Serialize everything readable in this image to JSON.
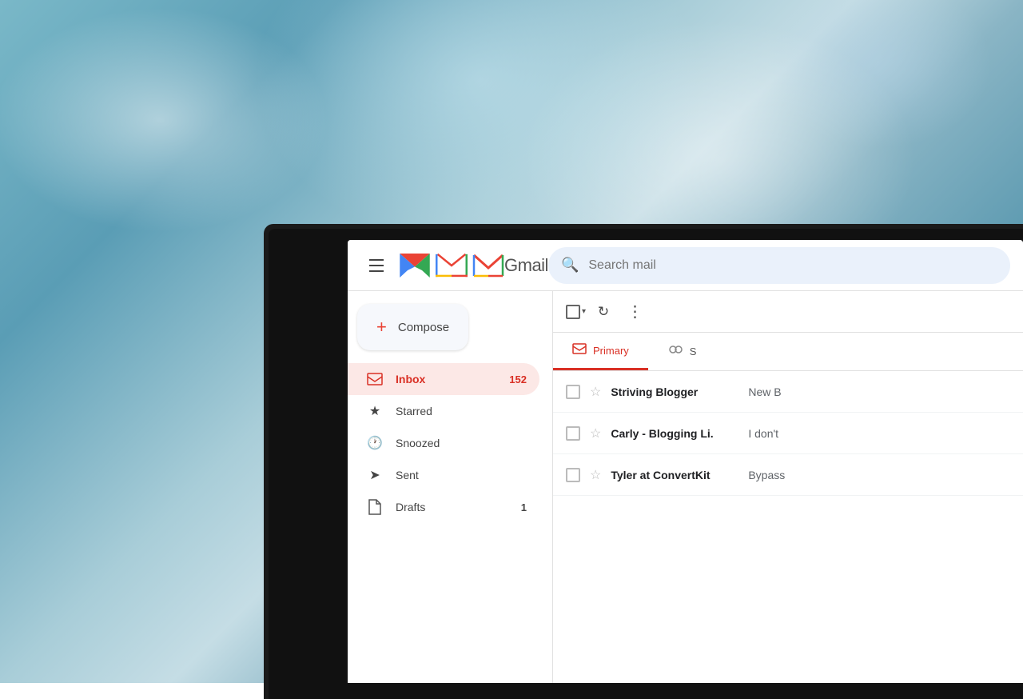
{
  "background": {
    "description": "Blurred blue-white abstract background"
  },
  "header": {
    "menu_label": "Main menu",
    "logo_text": "Gmail",
    "search_placeholder": "Search mail"
  },
  "compose": {
    "label": "Compose",
    "plus_symbol": "+"
  },
  "nav": {
    "items": [
      {
        "id": "inbox",
        "label": "Inbox",
        "icon": "inbox",
        "badge": "152",
        "active": true
      },
      {
        "id": "starred",
        "label": "Starred",
        "icon": "star",
        "badge": "",
        "active": false
      },
      {
        "id": "snoozed",
        "label": "Snoozed",
        "icon": "clock",
        "badge": "",
        "active": false
      },
      {
        "id": "sent",
        "label": "Sent",
        "icon": "send",
        "badge": "",
        "active": false
      },
      {
        "id": "drafts",
        "label": "Drafts",
        "icon": "draft",
        "badge": "1",
        "active": false
      }
    ]
  },
  "toolbar": {
    "select_all_label": "Select all",
    "refresh_label": "Refresh",
    "more_label": "More"
  },
  "tabs": [
    {
      "id": "primary",
      "label": "Primary",
      "icon": "inbox",
      "active": true
    },
    {
      "id": "social",
      "label": "S",
      "icon": "people",
      "active": false
    }
  ],
  "emails": [
    {
      "sender": "Striving Blogger",
      "snippet": "New B",
      "starred": false
    },
    {
      "sender": "Carly - Blogging Li.",
      "snippet": "I don't",
      "starred": false
    },
    {
      "sender": "Tyler at ConvertKit",
      "snippet": "Bypass",
      "starred": false
    }
  ]
}
